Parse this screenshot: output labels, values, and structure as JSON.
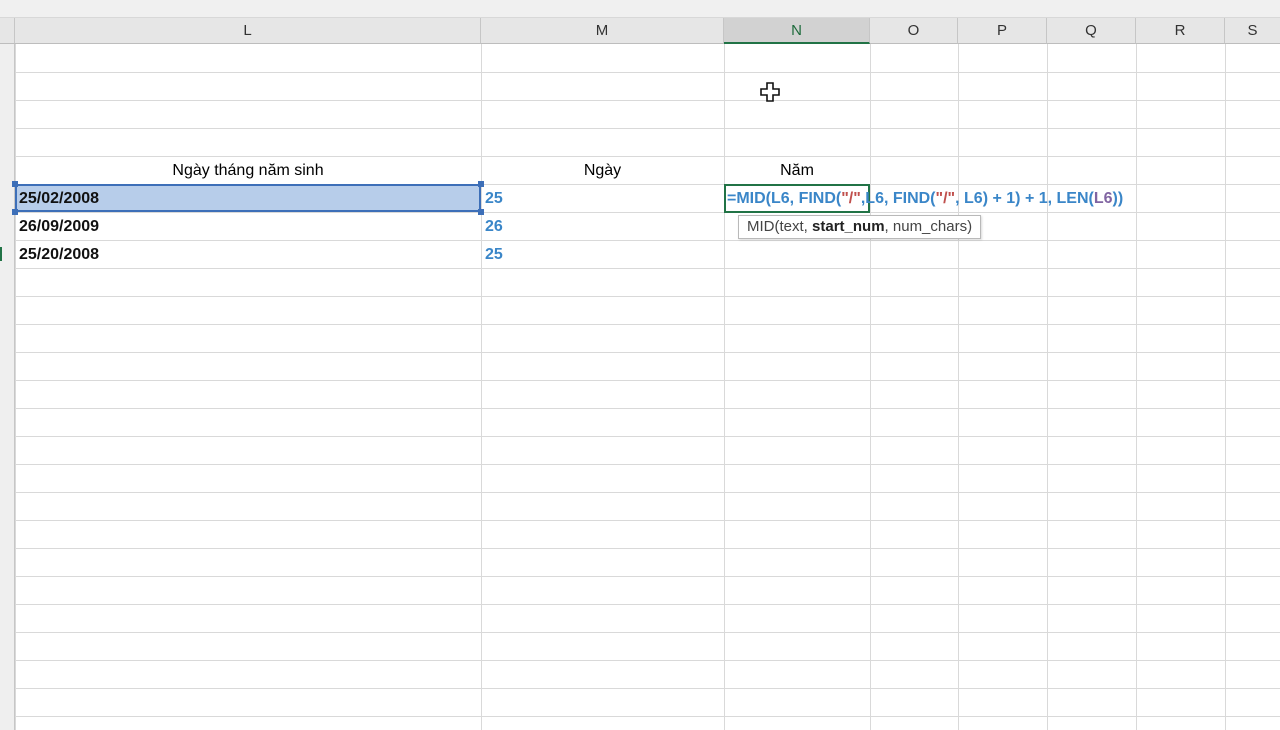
{
  "columns": [
    "L",
    "M",
    "N",
    "O",
    "P",
    "Q",
    "R",
    "S"
  ],
  "active_column": "N",
  "cells": {
    "header_birthdate": "Ngày tháng năm sinh",
    "header_day": "Ngày",
    "header_year": "Năm",
    "rows": [
      {
        "date": "25/02/2008",
        "day": "25"
      },
      {
        "date": "26/09/2009",
        "day": "26"
      },
      {
        "date": "25/20/2008",
        "day": "25"
      }
    ]
  },
  "formula": {
    "p1": "=MID(L6, FIND(",
    "p2": "\"/\"",
    "p3": ",L6, FIND(",
    "p4": "\"/\"",
    "p5": ", L6)",
    "p6": " + 1)",
    "p7": " + 1, LEN(",
    "p8": "L6",
    "p9": "))"
  },
  "tooltip": {
    "fn": "MID(text, ",
    "arg_bold": "start_num",
    "rest": ", num_chars)"
  },
  "colors": {
    "accent_green": "#217346",
    "selection_blue": "#b7cdea",
    "formula_blue": "#3a86c8",
    "formula_red": "#c0504d"
  },
  "icons": {
    "cursor": "plus-select-cursor-icon"
  }
}
